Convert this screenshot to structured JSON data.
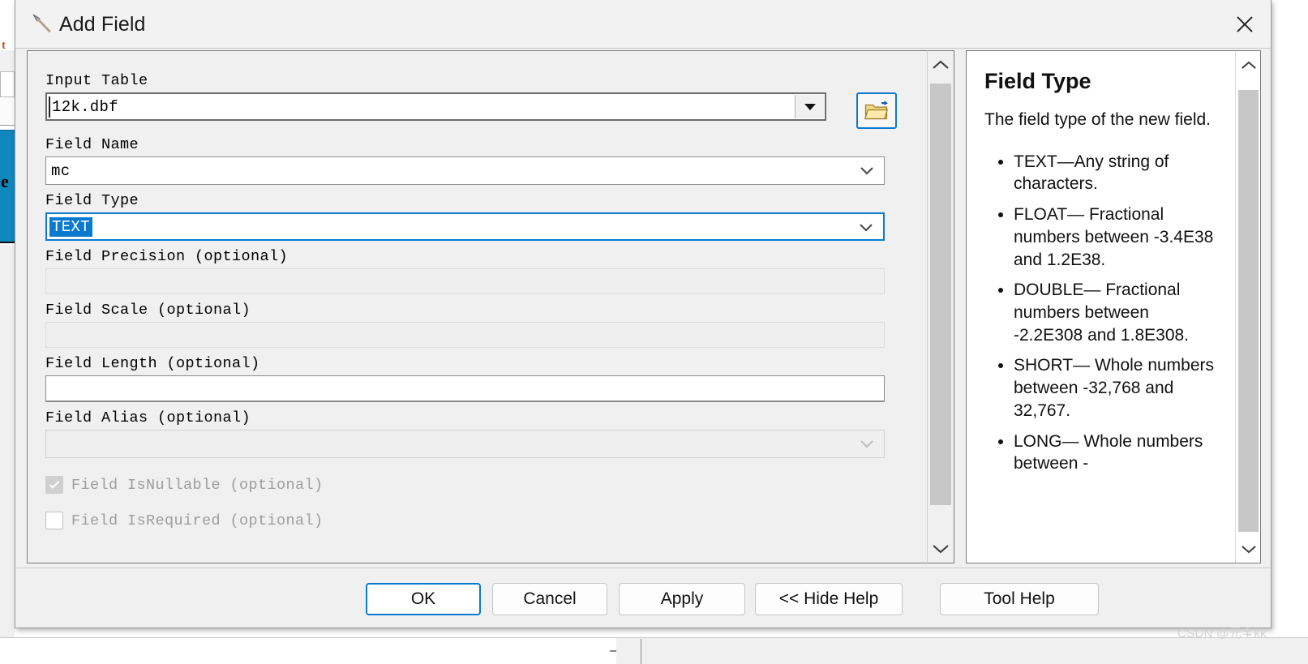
{
  "window": {
    "title": "Add Field",
    "icon": "hammer-icon",
    "close_label": "×"
  },
  "form": {
    "input_table": {
      "label": "Input Table",
      "value": "12k.dbf",
      "browse_icon": "open-folder-icon"
    },
    "field_name": {
      "label": "Field Name",
      "value": "mc"
    },
    "field_type": {
      "label": "Field Type",
      "value": "TEXT",
      "selected": true,
      "focus_color": "#0a7ad1",
      "selection_color": "#0a7ad1"
    },
    "field_precision": {
      "label": "Field Precision (optional)",
      "value": "",
      "disabled": true
    },
    "field_scale": {
      "label": "Field Scale (optional)",
      "value": "",
      "disabled": true
    },
    "field_length": {
      "label": "Field Length (optional)",
      "value": "",
      "disabled": false
    },
    "field_alias": {
      "label": "Field Alias (optional)",
      "value": "",
      "disabled": true
    },
    "field_isnullable": {
      "label": "Field IsNullable (optional)",
      "checked": true,
      "disabled": true
    },
    "field_isrequired": {
      "label": "Field IsRequired (optional)",
      "checked": false,
      "disabled": true
    }
  },
  "help": {
    "title": "Field Type",
    "intro": "The field type of the new field.",
    "items": [
      "TEXT—Any string of characters.",
      "FLOAT— Fractional numbers between -3.4E38 and 1.2E38.",
      "DOUBLE— Fractional numbers between -2.2E308 and 1.8E308.",
      "SHORT— Whole numbers between -32,768 and 32,767.",
      "LONG— Whole numbers between -"
    ]
  },
  "footer": {
    "ok": "OK",
    "cancel": "Cancel",
    "apply": "Apply",
    "hide_help": "<< Hide Help",
    "tool_help": "Tool Help"
  },
  "background": {
    "tab_fragment": "t",
    "selected_fragment": "e"
  },
  "watermark": "CSDN @元宝kk"
}
